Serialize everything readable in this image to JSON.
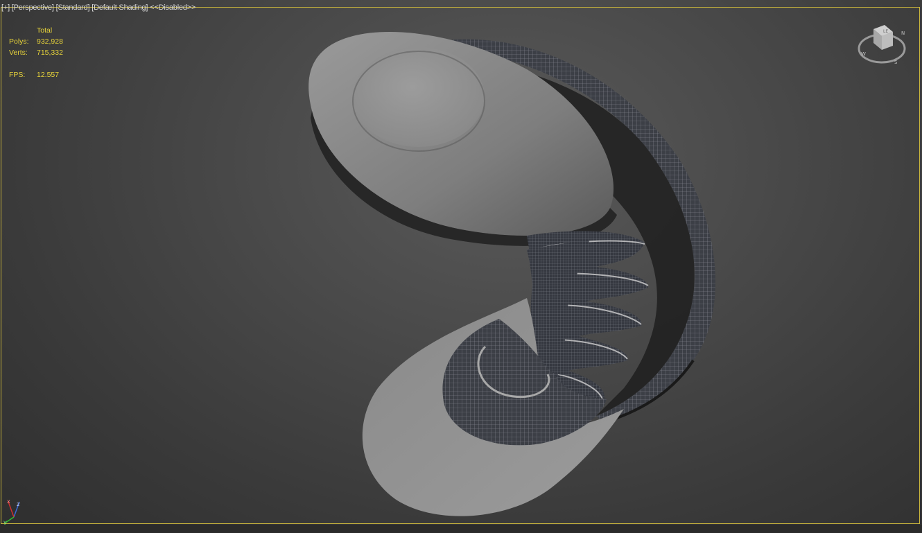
{
  "viewport": {
    "label_plus": "[+]",
    "label_view": "[Perspective]",
    "label_mode": "[Standard]",
    "label_shading": "[Default Shading]",
    "label_state": "<<Disabled>>"
  },
  "stats": {
    "header": "Total",
    "polys_label": "Polys:",
    "polys_value": "932,928",
    "verts_label": "Verts:",
    "verts_value": "715,332",
    "fps_label": "FPS:",
    "fps_value": "12.557"
  },
  "viewcube": {
    "icon": "viewcube-icon",
    "face_label": "LE",
    "compass_labels": [
      "N",
      "S",
      "W"
    ]
  },
  "axis": {
    "x": "x",
    "y": "y",
    "z": "z"
  },
  "colors": {
    "accent": "#e6d23a",
    "frame": "#c8b43c",
    "label": "#d8d8d8",
    "axis_x": "#d03030",
    "axis_y": "#30c030",
    "axis_z": "#3a6ad8"
  }
}
